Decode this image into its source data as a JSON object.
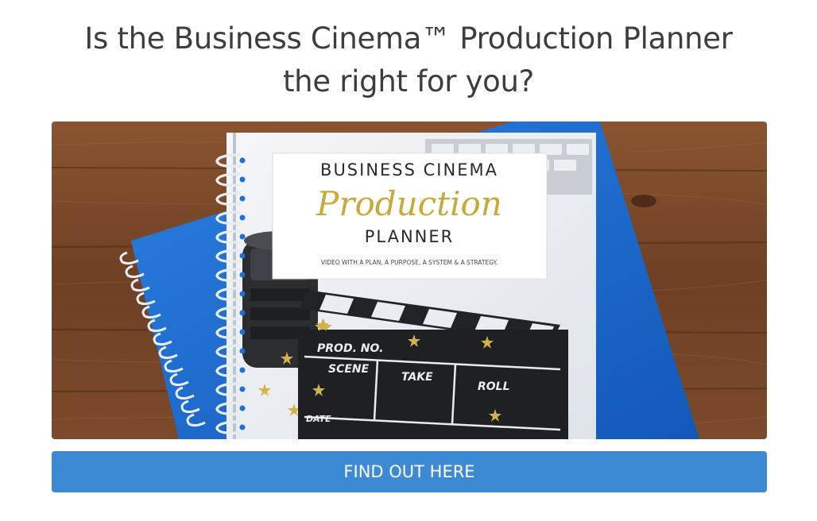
{
  "heading": {
    "line1": "Is the Business Cinema™ Production Planner",
    "line2": "the right for you?"
  },
  "hero": {
    "title_line1": "BUSINESS CINEMA",
    "title_script": "Production",
    "title_line2": "PLANNER",
    "tagline": "VIDEO WITH A PLAN, A PURPOSE, A SYSTEM & A STRATEGY.",
    "clapper": {
      "prod_no": "PROD. NO.",
      "scene": "SCENE",
      "take": "TAKE",
      "roll": "ROLL",
      "date": "DATE"
    },
    "colors": {
      "wood": "#7a4a2a",
      "blue_book": "#1f6fd6",
      "gold": "#c9a93a"
    }
  },
  "cta": {
    "label": "FIND OUT HERE",
    "color": "#3b8ad3"
  }
}
